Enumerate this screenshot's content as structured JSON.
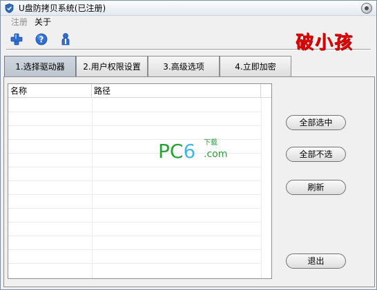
{
  "window": {
    "title": "U盘防拷贝系统(已注册)"
  },
  "menu": {
    "register": "注册",
    "about": "关于"
  },
  "toolbar": {
    "icons": [
      "plus-icon",
      "help-icon",
      "user-icon"
    ]
  },
  "brand": {
    "text": "破小孩",
    "color": "#e00000"
  },
  "tabs": [
    {
      "label": "1.选择驱动器",
      "active": true
    },
    {
      "label": "2.用户权限设置",
      "active": false
    },
    {
      "label": "3.高级选项",
      "active": false
    },
    {
      "label": "4.立即加密",
      "active": false
    }
  ],
  "list": {
    "columns": [
      "名称",
      "路径"
    ],
    "rows": []
  },
  "watermark": {
    "pc": "PC",
    "six": "6",
    "sub": "下载",
    "com": ".com"
  },
  "buttons": {
    "select_all": "全部选中",
    "deselect_all": "全部不选",
    "refresh": "刷新",
    "exit": "退出"
  },
  "colors": {
    "accent_green": "#2aa03a",
    "accent_blue": "#43b8e8",
    "window_bg": "#f0f0f0"
  }
}
